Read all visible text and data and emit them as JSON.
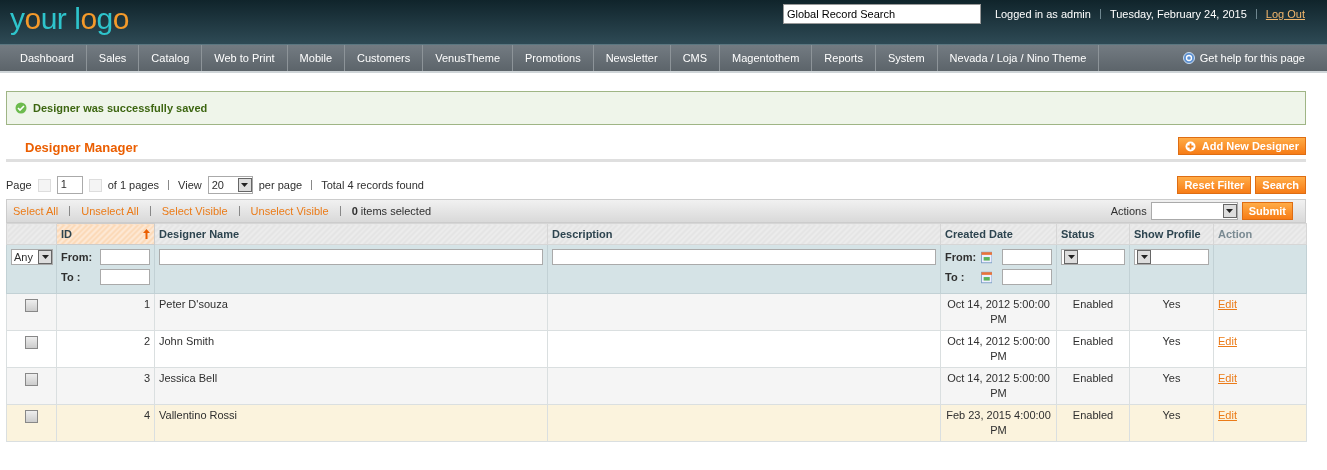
{
  "header": {
    "logo": [
      {
        "text": "y",
        "color": "#2ec4cc"
      },
      {
        "text": "o",
        "color": "#f59a2a"
      },
      {
        "text": "ur l",
        "color": "#2ec4cc"
      },
      {
        "text": "o",
        "color": "#f59a2a"
      },
      {
        "text": "g",
        "color": "#2ec4cc"
      },
      {
        "text": "o",
        "color": "#f59a2a"
      }
    ],
    "search": {
      "value": "Global Record Search"
    },
    "user": "Logged in as admin",
    "date": "Tuesday, February 24, 2015",
    "logout": "Log Out"
  },
  "nav": {
    "items": [
      "Dashboard",
      "Sales",
      "Catalog",
      "Web to Print",
      "Mobile",
      "Customers",
      "VenusTheme",
      "Promotions",
      "Newsletter",
      "CMS",
      "Magentothem",
      "Reports",
      "System",
      "Nevada / Loja / Nino Theme"
    ],
    "help": "Get help for this page"
  },
  "message": "Designer was successfully saved",
  "page_title": "Designer Manager",
  "add_button": "Add New Designer",
  "pager": {
    "page_label": "Page",
    "page": "1",
    "of_pages": "of 1 pages",
    "view_label": "View",
    "per_page": "20",
    "per_page_label": "per page",
    "total": "Total 4 records found"
  },
  "filter_buttons": [
    "Reset Filter",
    "Search"
  ],
  "massaction": {
    "links": [
      "Select All",
      "Unselect All",
      "Select Visible",
      "Unselect Visible"
    ],
    "count": "0",
    "count_label": "items selected",
    "actions_label": "Actions",
    "submit": "Submit"
  },
  "table": {
    "select_column": {
      "filter": {
        "kind": "select",
        "value": "Any"
      }
    },
    "columns": [
      {
        "label": "ID",
        "kind": "num",
        "sorted": true,
        "sortable": true,
        "filter": {
          "kind": "range",
          "from": "From:",
          "to": "To :"
        }
      },
      {
        "label": "Designer Name",
        "kind": "text",
        "sorted": false,
        "sortable": true,
        "filter": {
          "kind": "text"
        }
      },
      {
        "label": "Description",
        "kind": "text",
        "sorted": false,
        "sortable": true,
        "filter": {
          "kind": "text"
        }
      },
      {
        "label": "Created Date",
        "kind": "center",
        "sorted": false,
        "sortable": true,
        "filter": {
          "kind": "date_range",
          "from": "From:",
          "to": "To :"
        }
      },
      {
        "label": "Status",
        "kind": "center",
        "sorted": false,
        "sortable": true,
        "filter": {
          "kind": "select"
        }
      },
      {
        "label": "Show Profile",
        "kind": "center",
        "sorted": false,
        "sortable": true,
        "filter": {
          "kind": "select"
        }
      },
      {
        "label": "Action",
        "kind": "link",
        "sorted": false,
        "sortable": false,
        "filter": {
          "kind": "none"
        }
      }
    ],
    "rows": [
      {
        "checked": false,
        "highlighted": false,
        "cells": [
          "1",
          "Peter D'souza",
          "",
          "Oct 14, 2012 5:00:00 PM",
          "Enabled",
          "Yes",
          "Edit"
        ]
      },
      {
        "checked": false,
        "highlighted": false,
        "cells": [
          "2",
          "John Smith",
          "",
          "Oct 14, 2012 5:00:00 PM",
          "Enabled",
          "Yes",
          "Edit"
        ]
      },
      {
        "checked": false,
        "highlighted": false,
        "cells": [
          "3",
          "Jessica Bell",
          "",
          "Oct 14, 2012 5:00:00 PM",
          "Enabled",
          "Yes",
          "Edit"
        ]
      },
      {
        "checked": false,
        "highlighted": true,
        "cells": [
          "4",
          "Vallentino Rossi",
          "",
          "Feb 23, 2015 4:00:00 PM",
          "Enabled",
          "Yes",
          "Edit"
        ]
      }
    ]
  }
}
